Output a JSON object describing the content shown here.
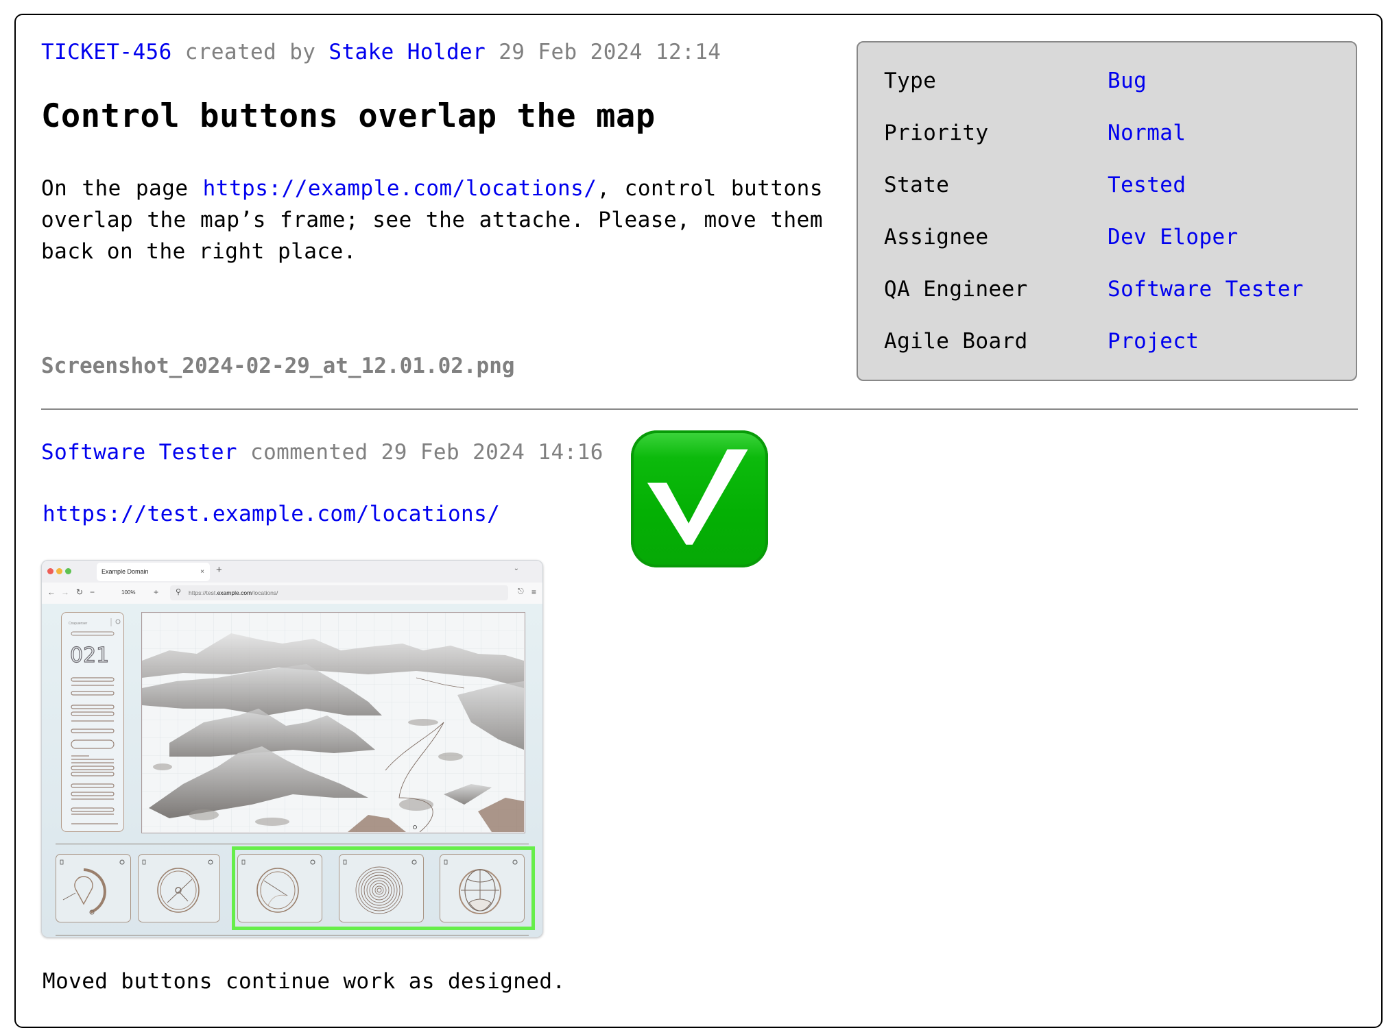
{
  "ticket": {
    "id": "TICKET-456",
    "created_by_label": " created by ",
    "author": "Stake Holder",
    "created_at": " 29 Feb 2024 12:14",
    "title": "Control buttons overlap the map",
    "description": {
      "prefix": "On the page ",
      "link": "https://example.com/locations/",
      "suffix": ", control buttons overlap the map’s frame; see the attache. Please, move them back on the right place."
    },
    "attachment_name": "Screenshot_2024-02-29_at_12.01.02.png"
  },
  "properties": [
    {
      "label": "Type",
      "value": "Bug"
    },
    {
      "label": "Priority",
      "value": "Normal"
    },
    {
      "label": "State",
      "value": "Tested"
    },
    {
      "label": "Assignee",
      "value": "Dev Eloper"
    },
    {
      "label": "QA Engineer",
      "value": "Software Tester"
    },
    {
      "label": "Agile Board",
      "value": "Project"
    }
  ],
  "comment": {
    "author": "Software Tester",
    "action_label": " commented ",
    "timestamp": "29 Feb 2024 14:16",
    "link": "https://test.example.com/locations/",
    "reaction_icon": "check-mark-button-icon",
    "text": "Moved buttons continue work as designed."
  },
  "embedded_screenshot": {
    "tab_title": "Example Domain",
    "tab_close": "×",
    "new_tab": "+",
    "zoom_level": "100%",
    "url_prefix": "https://test.",
    "url_domain": "example.com",
    "url_path": "/locations/",
    "panel_label": "Cnapuenser",
    "panel_counter": "021",
    "highlight_color": "#66ee4a"
  },
  "colors": {
    "link": "#0000ee",
    "muted": "#808080",
    "panel_bg": "#d9d9d9",
    "check_green": "#0cba0c"
  }
}
